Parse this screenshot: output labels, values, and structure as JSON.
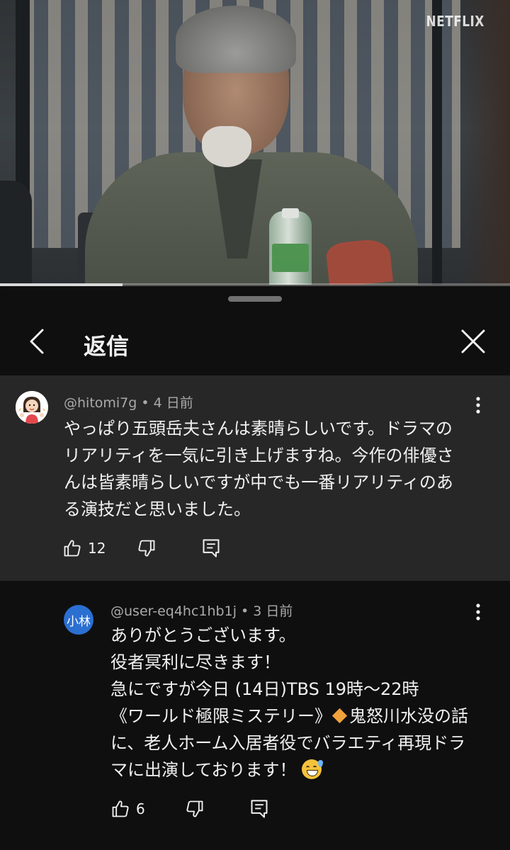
{
  "video": {
    "brand_logo": "NETFLIX",
    "progress": 0.24
  },
  "panel": {
    "title": "返信",
    "back_icon": "chevron-left-icon",
    "close_icon": "close-icon"
  },
  "parent_comment": {
    "author": "@hitomi7g",
    "time": "4 日前",
    "text_lines": [
      "やっぱり五頭岳夫さんは素晴らしいです。ドラマの",
      "リアリティを一気に引き上げますね。今作の俳優さ",
      "んは皆素晴らしいですが中でも一番リアリティのあ",
      "る演技だと思いました。"
    ],
    "like_count": "12"
  },
  "reply": {
    "avatar_text": "小林",
    "author": "@user-eq4hc1hb1j",
    "time": "3 日前",
    "line1": "ありがとうございます。",
    "line2": "役者冥利に尽きます！",
    "line3": "急にですが今日 (14日)TBS 19時〜22時",
    "line4a": "《ワールド極限ミステリー》",
    "line4b": "鬼怒川水没の話",
    "line5": "に、老人ホーム入居者役でバラエティ再現ドラ",
    "line6": "マに出演しております！",
    "like_count": "6"
  },
  "colors": {
    "background": "#0f0f0f",
    "highlight_row": "#272727",
    "reply_avatar": "#2b6fd1",
    "meta_text": "#aaaaaa"
  }
}
